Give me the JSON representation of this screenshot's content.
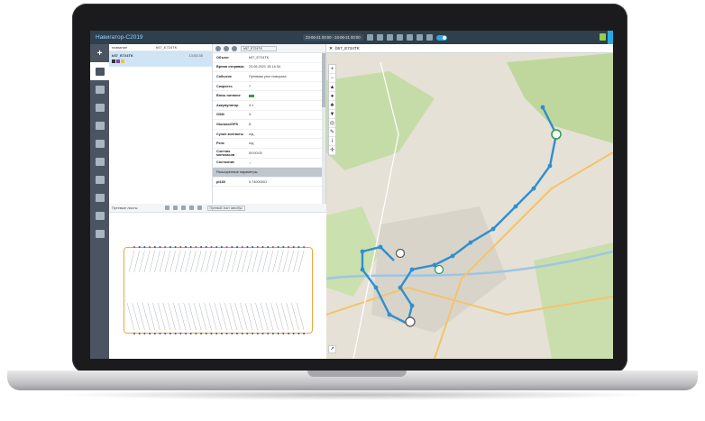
{
  "app": {
    "title": "Навигатор-С2019",
    "date_range": "23-06-21 00:00 - 24-06-21 00:00"
  },
  "objects": {
    "header_col1": "название",
    "header_filter": "b57_E724TK",
    "selected_name": "b57_E724TK",
    "selected_time": "13:53:35"
  },
  "properties": {
    "object_select": "b57_E724TK",
    "rows": [
      {
        "key": "Объект",
        "value": "b57_E724TK"
      },
      {
        "key": "Время отправки",
        "value": "23.06.2021 15:14:34"
      },
      {
        "key": "Событие",
        "value": "Путевым угол поворота"
      },
      {
        "key": "Скорость",
        "value": "7"
      },
      {
        "key": "Внеш питание",
        "value": ""
      },
      {
        "key": "Аккумулятор",
        "value": "4.1"
      },
      {
        "key": "GSM",
        "value": "3"
      },
      {
        "key": "Glonass/GPS",
        "value": "8"
      },
      {
        "key": "Сухие контакты",
        "value": "н/д"
      },
      {
        "key": "Реле",
        "value": "н/д"
      },
      {
        "key": "Счетчик моточасов",
        "value": "00:00:00"
      },
      {
        "key": "Состояние",
        "value": "✓"
      }
    ],
    "group_label": "Расширенные параметры",
    "extra_rows": [
      {
        "key": "pt160",
        "value": "0.74000001"
      }
    ]
  },
  "sheets": {
    "label": "Путевые листы",
    "select": "Путевой лист автобус"
  },
  "map": {
    "tab_label": "b57_E724TK",
    "tools": [
      "+",
      "−",
      "▲",
      "●",
      "♣",
      "▼",
      "◎",
      "✎",
      "i",
      "✛"
    ],
    "colors": {
      "route": "#2f8fd0",
      "land": "#e8e4d8",
      "forest": "#b9d39a",
      "road_major": "#f4c36b"
    }
  },
  "colors": {
    "topbar": "#2f3f4c",
    "accent": "#29a8e0",
    "rail": "#4b5561",
    "selection": "#cfe4f4",
    "route_sheet_box": "#f0a340"
  }
}
